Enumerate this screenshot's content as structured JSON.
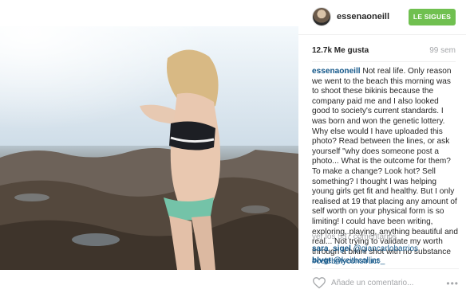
{
  "header": {
    "username": "essenaoneill",
    "follow_label": "LE SIGUES"
  },
  "stats": {
    "likes": "12.7k Me gusta",
    "age": "99 sem"
  },
  "caption": {
    "author": "essenaoneill",
    "text": " Not real life. Only reason we went to the beach this morning was to shoot these bikinis because the company paid me and I also looked good to society's current standards. I was born and won the genetic lottery. Why else would I have uploaded this photo? Read between the lines, or ask yourself \"why does someone post a photo... What is the outcome for them? To make a change? Look hot? Sell something? I thought I was helping young girls get fit and healthy. But I only realised at 19 that placing any amount of self worth on your physical form is so limiting! I could have been writing, exploring, playing, anything beautiful and real... Not trying to validate my worth through a bikini shot with no substance ",
    "hashtag": "#celebrityconstruct"
  },
  "comments": {
    "view_all": "ver los 557 comentarios",
    "items": [
      {
        "user": "sara_sigel",
        "mention": "@giancarlobarrios"
      },
      {
        "user": "blvgt",
        "mention": "@keithcollins_"
      }
    ]
  },
  "footer": {
    "placeholder": "Añade un comentario...",
    "more": "•••"
  },
  "colors": {
    "follow_button": "#70c050",
    "link": "#125688",
    "muted": "#a5a7aa"
  },
  "icons": [
    "heart-icon",
    "more-options-icon",
    "avatar"
  ]
}
